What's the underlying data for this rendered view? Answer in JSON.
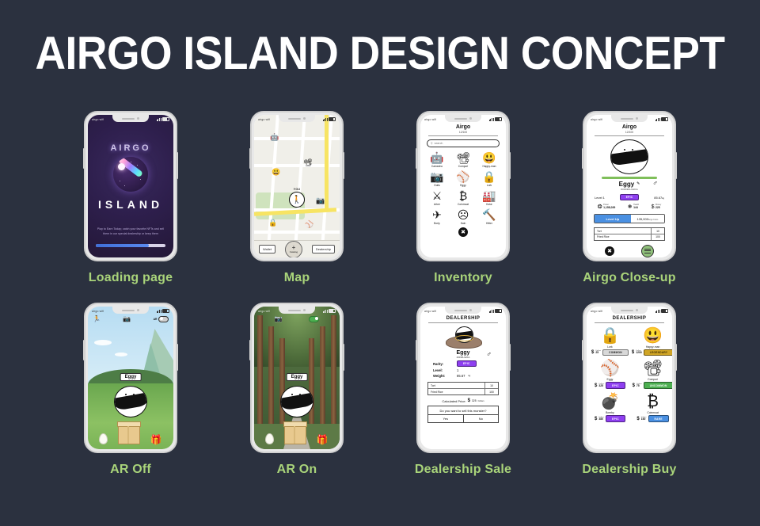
{
  "page": {
    "title": "AIRGO ISLAND DESIGN CONCEPT",
    "background": "#2b313f",
    "caption_color": "#a9d47a"
  },
  "screens": [
    {
      "caption": "Loading page",
      "status": {
        "carrier": "airgo wifi",
        "time": "",
        "battery": ""
      },
      "logo_top": "AIRGO",
      "logo_bottom": "ISLAND",
      "tagline": "Play to Earn Today; catch your favorite NFTs and sell them in our special dealership or keep them",
      "progress_percent": 76
    },
    {
      "caption": "Map",
      "you_label": "YOU",
      "buttons": {
        "wallet": "Wallet",
        "catalog": "Catalog",
        "dealership": "Dealership"
      },
      "markers": [
        "robot",
        "compuri",
        "happy-man",
        "goits",
        "eggy",
        "lork"
      ]
    },
    {
      "caption": "Inventory",
      "title": "Airgo",
      "subtitle": "12/100",
      "search_placeholder": "search",
      "items": [
        {
          "name": "Camarino",
          "icon": "robot-icon",
          "glyph": "🤖"
        },
        {
          "name": "Compuri",
          "icon": "camera-monster-icon",
          "glyph": "📽"
        },
        {
          "name": "Happy-man",
          "icon": "happy-man-icon",
          "glyph": "😃"
        },
        {
          "name": "Goits",
          "icon": "goits-icon",
          "glyph": "📷"
        },
        {
          "name": "Eggy",
          "icon": "eggy-icon",
          "glyph": "⚾"
        },
        {
          "name": "Lork",
          "icon": "lock-icon",
          "glyph": "🔒"
        },
        {
          "name": "Arker",
          "icon": "arker-icon",
          "glyph": "⚔"
        },
        {
          "name": "Coinmoat",
          "icon": "bitcoin-icon",
          "glyph": "₿"
        },
        {
          "name": "Koke",
          "icon": "koke-icon",
          "glyph": "🏭"
        },
        {
          "name": "Borty",
          "icon": "plane-icon",
          "glyph": "✈"
        },
        {
          "name": "Kain",
          "icon": "sad-face-icon",
          "glyph": "☹"
        },
        {
          "name": "Hitter",
          "icon": "hammer-icon",
          "glyph": "🔨"
        }
      ],
      "close_label": "✖"
    },
    {
      "caption": "Airgo Close-up",
      "title": "Airgo",
      "subtitle": "12/100",
      "name": "Eggy",
      "id": "#30039U12KA",
      "gender": "♂",
      "level_label": "Level 1",
      "rarity": "EPIC",
      "rarity_color": "#8e3ff0",
      "weight": "85.67",
      "weight_unit": "kg",
      "stats": [
        {
          "label": "Power",
          "value": "1,158,039",
          "icon": "clock-icon",
          "glyph": "❂"
        },
        {
          "label": "Health",
          "value": "144",
          "icon": "shield-icon",
          "glyph": "⬟"
        },
        {
          "label": "Money",
          "value": "225",
          "icon": "dollar-icon",
          "glyph": "$"
        }
      ],
      "level_up_label": "Level Up",
      "level_up_cost": "135,000",
      "level_up_unit": "Airgo Coins",
      "inventory": [
        {
          "name": "Tort",
          "qty": "10"
        },
        {
          "name": "Fried Rice",
          "qty": "100"
        }
      ],
      "close_label": "✖"
    },
    {
      "caption": "AR Off",
      "ar_label": "AR",
      "ar_on": false,
      "name_tag": "Eggy",
      "icons": {
        "run": "run-icon",
        "camera": "camera-icon"
      },
      "items": [
        "egg",
        "box",
        "gift"
      ]
    },
    {
      "caption": "AR On",
      "ar_label": "AR",
      "ar_on": true,
      "name_tag": "Eggy",
      "icons": {
        "camera": "camera-icon"
      },
      "items": [
        "egg",
        "box",
        "gift"
      ]
    },
    {
      "caption": "Dealership Sale",
      "title": "DEALERSHIP",
      "name": "Eggy",
      "id": "40039U12KA",
      "gender": "♂",
      "attrs": [
        {
          "key": "Rarity:",
          "value": "EPIC"
        },
        {
          "key": "Level:",
          "value": "1"
        },
        {
          "key": "Weight:",
          "value": "85.67",
          "unit": "kg"
        }
      ],
      "rarity_color": "#8e3ff0",
      "inventory": [
        {
          "name": "Tort",
          "qty": "10"
        },
        {
          "name": "Fried Rice",
          "qty": "100"
        }
      ],
      "price_label": "Calculated Price:",
      "price_symbol": "$",
      "price_value": "325",
      "price_unit": "Dollars",
      "question": "Do you want to sell this monster?",
      "yes_label": "Yes",
      "no_label": "No"
    },
    {
      "caption": "Dealership Buy",
      "title": "DEALERSHIP",
      "offers": [
        {
          "name": "Lork",
          "glyph": "🔒",
          "icon": "lock-icon",
          "price": "25",
          "price_unit": "Dollars",
          "rarity": "COMMON",
          "color": "#d8d8d8",
          "text_color": "#111111"
        },
        {
          "name": "Happy-man",
          "glyph": "😃",
          "icon": "happy-man-icon",
          "price": "1200",
          "price_unit": "Dollars",
          "rarity": "LEGENDARY",
          "color": "#d0a526",
          "text_color": "#3a2a00"
        },
        {
          "name": "Eggy",
          "glyph": "⚾",
          "icon": "eggy-icon",
          "price": "325",
          "price_unit": "Dollars",
          "rarity": "EPIC",
          "color": "#8e3ff0",
          "text_color": "#ffffff"
        },
        {
          "name": "Compuri",
          "glyph": "📽",
          "icon": "camera-monster-icon",
          "price": "75",
          "price_unit": "Dollars",
          "rarity": "UNCOMMON",
          "color": "#4caf50",
          "text_color": "#ffffff"
        },
        {
          "name": "Bomby",
          "glyph": "💣",
          "icon": "bomb-icon",
          "price": "380",
          "price_unit": "Dollars",
          "rarity": "EPIC",
          "color": "#8e3ff0",
          "text_color": "#ffffff"
        },
        {
          "name": "Coinmoat",
          "glyph": "₿",
          "icon": "bitcoin-icon",
          "price": "160",
          "price_unit": "Dollars",
          "rarity": "RARE",
          "color": "#4a90e2",
          "text_color": "#ffffff"
        }
      ]
    }
  ]
}
